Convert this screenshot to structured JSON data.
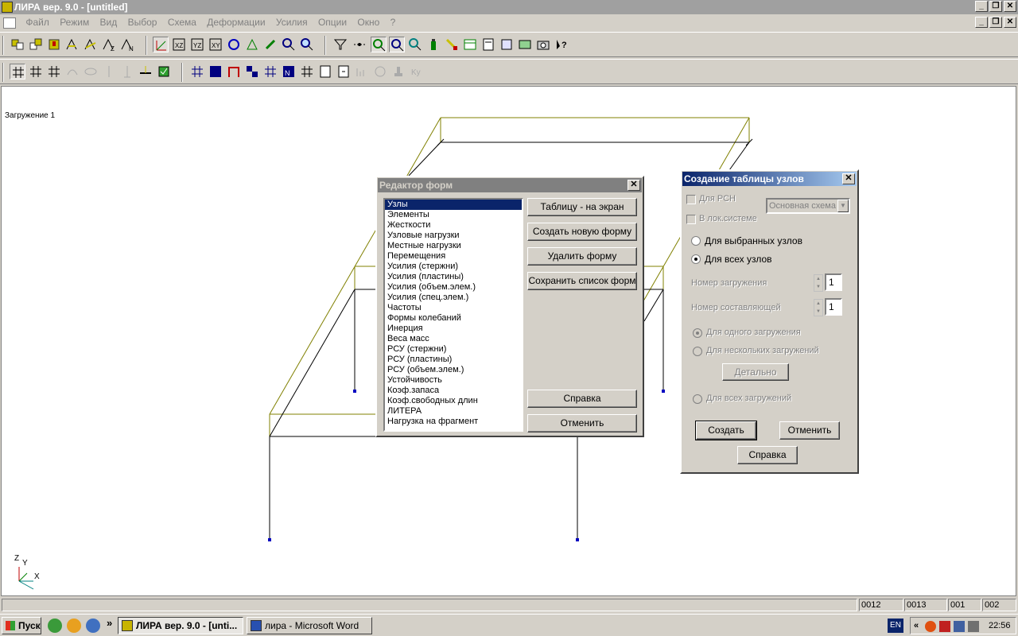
{
  "app": {
    "title": "ЛИРА  вер. 9.0 - [untitled]"
  },
  "menu": [
    "Файл",
    "Режим",
    "Вид",
    "Выбор",
    "Схема",
    "Деформации",
    "Усилия",
    "Опции",
    "Окно",
    "?"
  ],
  "canvas": {
    "load_label": "Загружение  1",
    "axes": {
      "z": "Z",
      "y": "Y",
      "x": "X"
    }
  },
  "form_editor": {
    "title": "Редактор форм",
    "items": [
      "Узлы",
      "Элементы",
      "Жесткости",
      "Узловые нагрузки",
      "Местные нагрузки",
      "Перемещения",
      "Усилия (стержни)",
      "Усилия (пластины)",
      "Усилия (объем.элем.)",
      "Усилия (спец.элем.)",
      "Частоты",
      "Формы колебаний",
      "Инерция",
      "Веса масс",
      "РСУ (стержни)",
      "РСУ (пластины)",
      "РСУ (объем.элем.)",
      "Устойчивость",
      "Коэф.запаса",
      "Коэф.свободных длин",
      "ЛИТЕРА",
      "Нагрузка на фрагмент"
    ],
    "selected_index": 0,
    "buttons": {
      "table_to_screen": "Таблицу - на экран",
      "create_form": "Создать новую форму",
      "delete_form": "Удалить форму",
      "save_list": "Сохранить список форм",
      "help": "Справка",
      "cancel": "Отменить"
    }
  },
  "node_table": {
    "title": "Создание таблицы узлов",
    "for_rsn": "Для РСН",
    "scheme_combo": "Основная схема",
    "local_system": "В лок.системе",
    "selected_nodes": "Для выбранных узлов",
    "all_nodes": "Для всех узлов",
    "load_number_label": "Номер загружения",
    "load_number": "1",
    "component_number_label": "Номер составляющей",
    "component_number": "1",
    "one_load": "Для одного    загружения",
    "several_loads": "Для нескольких    загружений",
    "details": "Детально",
    "all_loads": "Для всех загружений",
    "create": "Создать",
    "cancel": "Отменить",
    "help": "Справка"
  },
  "statusbar": [
    "",
    "0012",
    "0013",
    "001",
    "002"
  ],
  "taskbar": {
    "start": "Пуск",
    "tasks": [
      "ЛИРА  вер. 9.0 - [unti...",
      "лира - Microsoft Word"
    ],
    "lang": "EN",
    "time": "22:56",
    "chevron": "»",
    "tray_chevron": "«"
  },
  "colors": {
    "frame_olive": "#808000",
    "frame_black": "#000000",
    "support_blue": "#0000c0",
    "selection": "#0a246a"
  }
}
